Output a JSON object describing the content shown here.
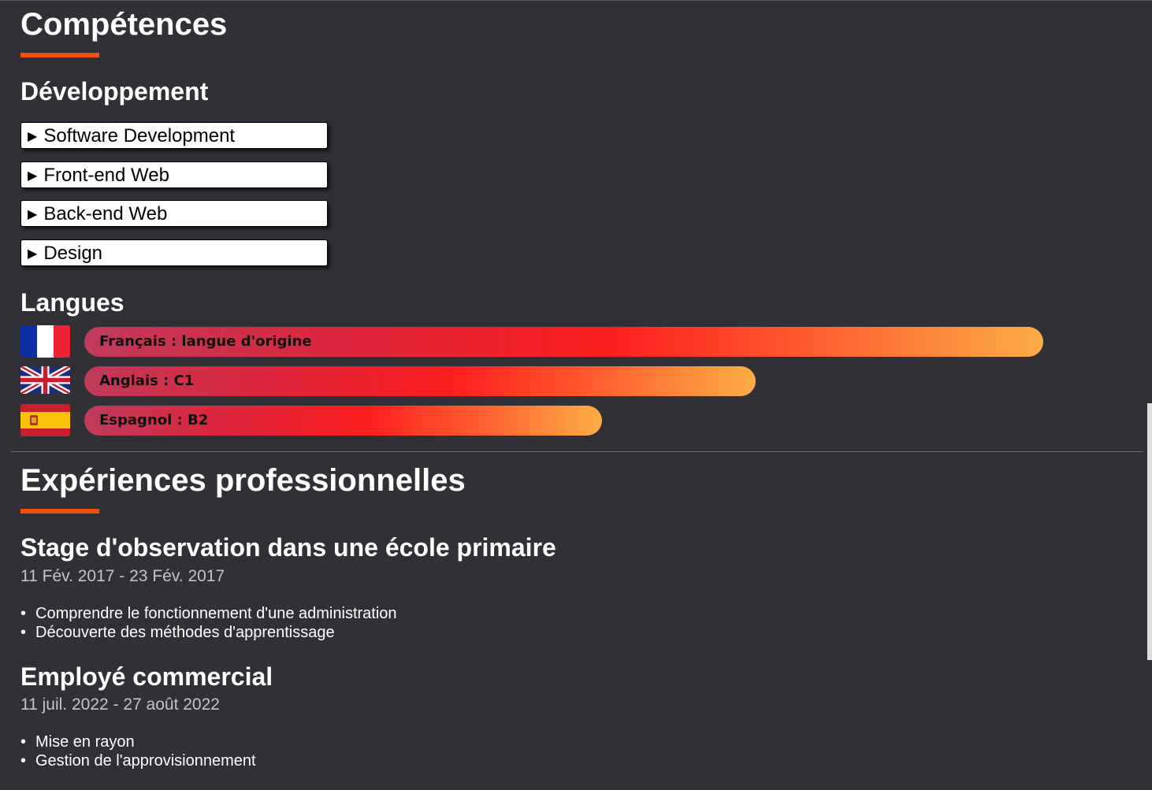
{
  "competences": {
    "title": "Compétences",
    "development": {
      "title": "Développement",
      "items": [
        {
          "label": "Software Development"
        },
        {
          "label": "Front-end Web"
        },
        {
          "label": "Back-end Web"
        },
        {
          "label": "Design"
        }
      ]
    },
    "languages": {
      "title": "Langues",
      "items": [
        {
          "label": "Français : langue d'origine",
          "flag": "france-flag-icon",
          "level": 1.0
        },
        {
          "label": "Anglais : C1",
          "flag": "uk-flag-icon",
          "level": 0.7
        },
        {
          "label": "Espagnol : B2",
          "flag": "spain-flag-icon",
          "level": 0.54
        }
      ]
    }
  },
  "experiences": {
    "title": "Expériences professionnelles",
    "items": [
      {
        "title": "Stage d'observation dans une école primaire",
        "dates": "11 Fév. 2017 - 23 Fév. 2017",
        "tasks": [
          "Comprendre le fonctionnement d'une administration",
          "Découverte des méthodes d'apprentissage"
        ]
      },
      {
        "title": "Employé commercial",
        "dates": "11 juil. 2022 - 27 août 2022",
        "tasks": [
          "Mise en rayon",
          "Gestion de l'approvisionnement"
        ]
      }
    ]
  },
  "colors": {
    "background": "#303036",
    "accent": "#f04e0a",
    "bar_gradient": [
      "#bf3a5a",
      "#fd1f1f",
      "#fbad46"
    ]
  }
}
